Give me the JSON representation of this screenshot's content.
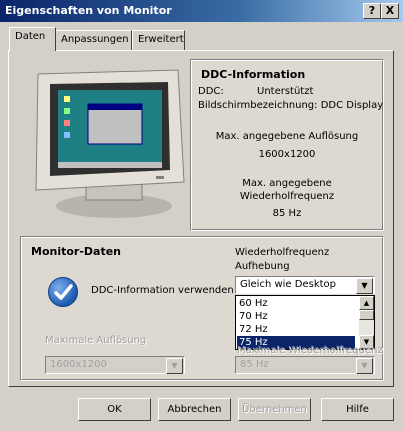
{
  "window": {
    "title": "Eigenschaften von Monitor",
    "help_button": "?",
    "close_button": "X"
  },
  "tabs": [
    {
      "label": "Daten",
      "active": true
    },
    {
      "label": "Anpassungen",
      "active": false
    },
    {
      "label": "Erweitert",
      "active": false
    }
  ],
  "ddc_panel": {
    "title": "DDC-Information",
    "ddc_label": "DDC:",
    "ddc_value": "Unterstützt",
    "display_name": "Bildschirmbezeichnung: DDC Display",
    "max_res_label": "Max. angegebene Auflösung",
    "max_res_value": "1600x1200",
    "max_freq_label_line1": "Max. angegebene",
    "max_freq_label_line2": "Wiederholfrequenz",
    "max_freq_value": "85 Hz"
  },
  "monitor_data": {
    "title": "Monitor-Daten",
    "ddc_use_label": "DDC-Information verwenden",
    "ddc_use_checked": true,
    "refresh_override_label_line1": "Wiederholfrequenz",
    "refresh_override_label_line2": "Aufhebung",
    "refresh_override_value": "Gleich wie Desktop",
    "refresh_options": [
      "60 Hz",
      "70 Hz",
      "72 Hz",
      "75 Hz"
    ],
    "refresh_selected": "75 Hz",
    "max_resolution_label": "Maximale Auflösung",
    "max_resolution_value": "1600x1200",
    "max_refresh_label": "Maximale Wiederholfrequenz",
    "max_refresh_value": "85 Hz"
  },
  "buttons": {
    "ok": "OK",
    "cancel": "Abbrechen",
    "apply": "Übernehmen",
    "help": "Hilfe"
  },
  "colors": {
    "titlebar": "#0a246a",
    "selection": "#0a246a",
    "dialog_bg": "#d4d0c8",
    "check_icon": "#1c5ab0"
  }
}
